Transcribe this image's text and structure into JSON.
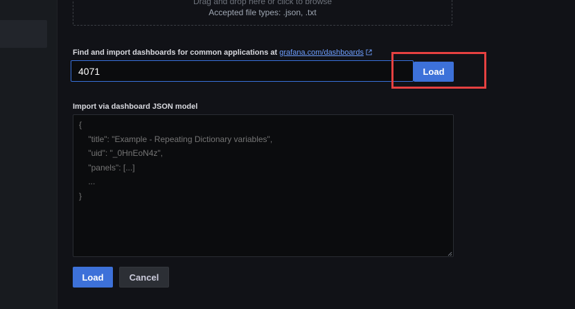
{
  "dropzone": {
    "line1": "Drag and drop here or click to browse",
    "line2": "Accepted file types: .json, .txt"
  },
  "grafana_import": {
    "label_prefix": "Find and import dashboards for common applications at ",
    "link_text": "grafana.com/dashboards",
    "input_value": "4071",
    "load_label": "Load"
  },
  "json_import": {
    "label": "Import via dashboard JSON model",
    "placeholder": "{\n    \"title\": \"Example - Repeating Dictionary variables\",\n    \"uid\": \"_0HnEoN4z\",\n    \"panels\": [...]\n    ...\n}"
  },
  "footer": {
    "load_label": "Load",
    "cancel_label": "Cancel"
  },
  "colors": {
    "primary": "#3d71d9",
    "highlight": "#e64141",
    "background": "#111217"
  }
}
